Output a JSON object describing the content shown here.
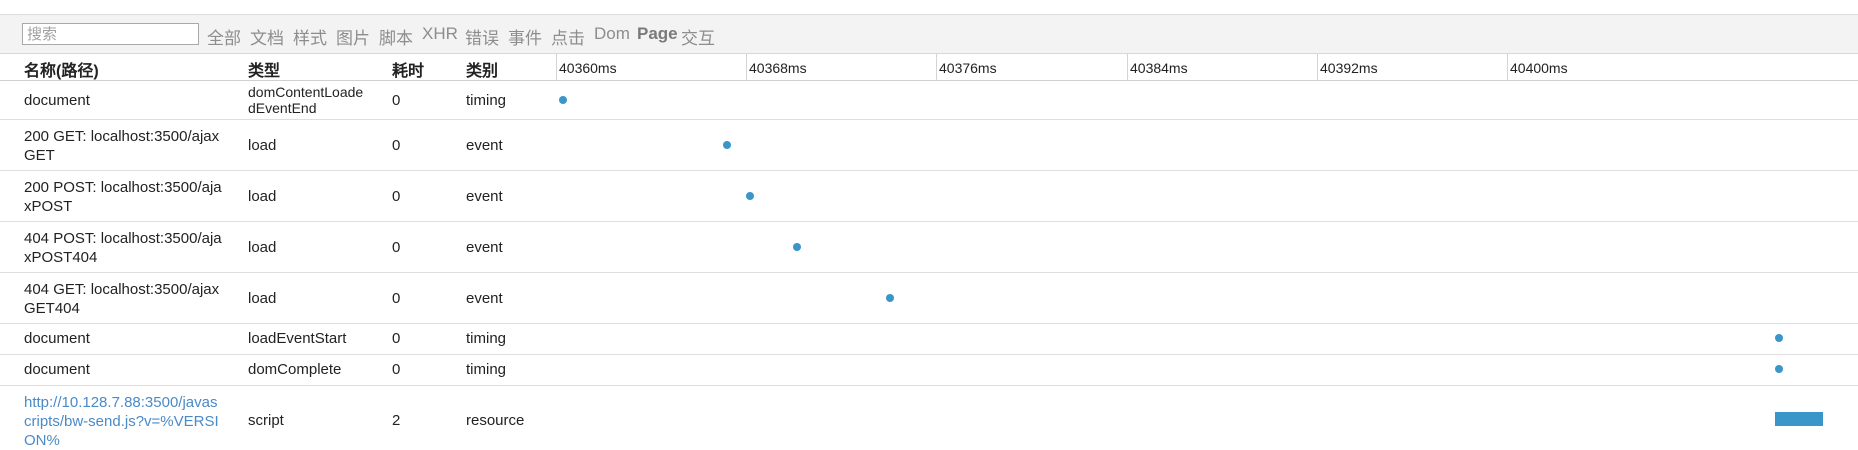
{
  "toolbar": {
    "search_placeholder": "搜索",
    "filters": [
      "全部",
      "文档",
      "样式",
      "图片",
      "脚本",
      "XHR",
      "错误",
      "事件",
      "点击",
      "Dom",
      "Page",
      "交互"
    ]
  },
  "table": {
    "columns": [
      "名称(路径)",
      "类型",
      "耗时",
      "类别"
    ],
    "timeline_ticks": [
      "40360ms",
      "40368ms",
      "40376ms",
      "40384ms",
      "40392ms",
      "40400ms"
    ],
    "rows": [
      {
        "name": "document",
        "type": "domContentLoadedEventEnd",
        "duration": "0",
        "category": "timing"
      },
      {
        "name": "200 GET: localhost:3500/ajaxGET",
        "type": "load",
        "duration": "0",
        "category": "event"
      },
      {
        "name": "200 POST: localhost:3500/ajaxPOST",
        "type": "load",
        "duration": "0",
        "category": "event"
      },
      {
        "name": "404 POST: localhost:3500/ajaxPOST404",
        "type": "load",
        "duration": "0",
        "category": "event"
      },
      {
        "name": "404 GET: localhost:3500/ajaxGET404",
        "type": "load",
        "duration": "0",
        "category": "event"
      },
      {
        "name": "document",
        "type": "loadEventStart",
        "duration": "0",
        "category": "timing"
      },
      {
        "name": "document",
        "type": "domComplete",
        "duration": "0",
        "category": "timing"
      },
      {
        "name": "http://10.128.7.88:3500/javascripts/bw-send.js?v=%VERSION%",
        "type": "script",
        "duration": "2",
        "category": "resource"
      }
    ]
  },
  "colors": {
    "marker": "#3a95c9",
    "link": "#4a8ac8"
  }
}
